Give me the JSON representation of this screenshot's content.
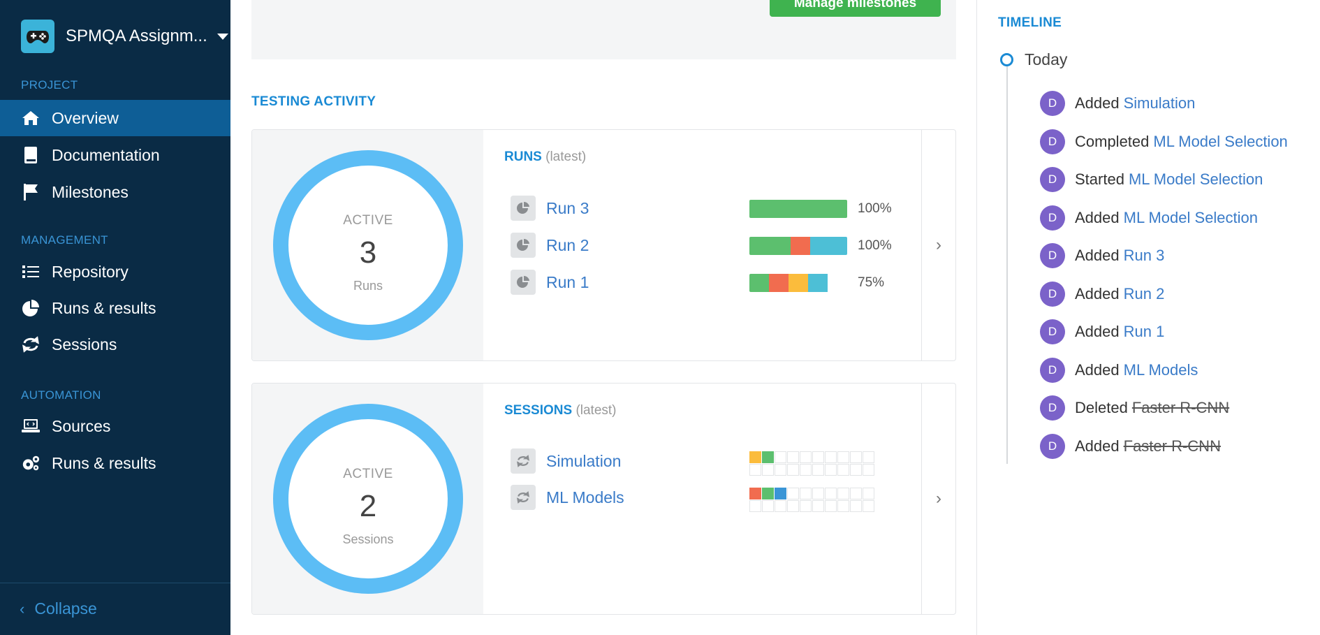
{
  "sidebar": {
    "project_name": "SPMQA Assignm...",
    "sections": {
      "project": "PROJECT",
      "management": "MANAGEMENT",
      "automation": "AUTOMATION"
    },
    "items": [
      {
        "label": "Overview",
        "icon": "home-icon",
        "active": true
      },
      {
        "label": "Documentation",
        "icon": "book-icon"
      },
      {
        "label": "Milestones",
        "icon": "flag-icon"
      },
      {
        "label": "Repository",
        "icon": "list-icon"
      },
      {
        "label": "Runs & results",
        "icon": "pie-chart-icon"
      },
      {
        "label": "Sessions",
        "icon": "sync-icon"
      },
      {
        "label": "Sources",
        "icon": "laptop-code-icon"
      },
      {
        "label": "Runs & results",
        "icon": "gears-icon"
      }
    ],
    "collapse_label": "Collapse"
  },
  "main": {
    "manage_milestones_label": "Manage milestones",
    "testing_activity_title": "TESTING ACTIVITY",
    "runs_card": {
      "active_label": "ACTIVE",
      "count": "3",
      "unit": "Runs",
      "title": "RUNS",
      "qualifier": "(latest)",
      "rows": [
        {
          "name": "Run 3",
          "percent": "100%",
          "segments": [
            {
              "color": "#5cbf6e",
              "fraction": 1.0
            }
          ]
        },
        {
          "name": "Run 2",
          "percent": "100%",
          "segments": [
            {
              "color": "#5cbf6e",
              "fraction": 0.42
            },
            {
              "color": "#f16c4f",
              "fraction": 0.2
            },
            {
              "color": "#4dbfd6",
              "fraction": 0.38
            }
          ]
        },
        {
          "name": "Run 1",
          "percent": "75%",
          "segments": [
            {
              "color": "#5cbf6e",
              "fraction": 0.2
            },
            {
              "color": "#f16c4f",
              "fraction": 0.2
            },
            {
              "color": "#fbbc3c",
              "fraction": 0.2
            },
            {
              "color": "#4dbfd6",
              "fraction": 0.2
            }
          ]
        }
      ]
    },
    "sessions_card": {
      "active_label": "ACTIVE",
      "count": "2",
      "unit": "Sessions",
      "title": "SESSIONS",
      "qualifier": "(latest)",
      "rows": [
        {
          "name": "Simulation",
          "cells": [
            "#fbbc3c",
            "#5cbf6e"
          ]
        },
        {
          "name": "ML Models",
          "cells": [
            "#f16c4f",
            "#5cbf6e",
            "#3a95d6"
          ]
        }
      ]
    }
  },
  "timeline": {
    "title": "TIMELINE",
    "today": "Today",
    "avatar_initial": "D",
    "events": [
      {
        "verb": "Added",
        "target": "Simulation",
        "strike": false
      },
      {
        "verb": "Completed",
        "target": "ML Model Selection",
        "strike": false
      },
      {
        "verb": "Started",
        "target": "ML Model Selection",
        "strike": false
      },
      {
        "verb": "Added",
        "target": "ML Model Selection",
        "strike": false
      },
      {
        "verb": "Added",
        "target": "Run 3",
        "strike": false
      },
      {
        "verb": "Added",
        "target": "Run 2",
        "strike": false
      },
      {
        "verb": "Added",
        "target": "Run 1",
        "strike": false
      },
      {
        "verb": "Added",
        "target": "ML Models",
        "strike": false
      },
      {
        "verb": "Deleted",
        "target": "Faster R-CNN",
        "strike": true
      },
      {
        "verb": "Added",
        "target": "Faster R-CNN",
        "strike": true
      }
    ]
  }
}
